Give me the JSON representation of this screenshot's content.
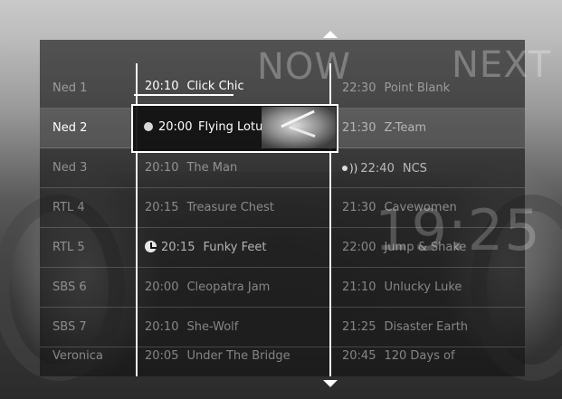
{
  "headers": {
    "now": "NOW",
    "next": "NEXT"
  },
  "clock": "19:25",
  "selected": {
    "time": "20:00",
    "title": "Flying Lotus"
  },
  "rows": [
    {
      "channel": "Ned 1",
      "now_time": "20:10",
      "now_title": "Click Chic",
      "next_time": "22:30",
      "next_title": "Point Blank"
    },
    {
      "channel": "Ned 2",
      "now_time": "20:00",
      "now_title": "Flying Lotus",
      "next_time": "21:30",
      "next_title": "Z-Team"
    },
    {
      "channel": "Ned 3",
      "now_time": "20:10",
      "now_title": "The Man",
      "next_time": "22:40",
      "next_title": "NCS"
    },
    {
      "channel": "RTL 4",
      "now_time": "20:15",
      "now_title": "Treasure Chest",
      "next_time": "21:30",
      "next_title": "Cavewomen"
    },
    {
      "channel": "RTL 5",
      "now_time": "20:15",
      "now_title": "Funky Feet",
      "next_time": "22:00",
      "next_title": "Jump & Shake"
    },
    {
      "channel": "SBS 6",
      "now_time": "20:00",
      "now_title": "Cleopatra Jam",
      "next_time": "21:10",
      "next_title": "Unlucky Luke"
    },
    {
      "channel": "SBS 7",
      "now_time": "20:10",
      "now_title": "She-Wolf",
      "next_time": "21:25",
      "next_title": "Disaster Earth"
    },
    {
      "channel": "Veronica",
      "now_time": "20:05",
      "now_title": "Under The Bridge",
      "next_time": "20:45",
      "next_title": "120 Days of"
    }
  ],
  "icons": {
    "scroll_up": "triangle-up",
    "scroll_down": "triangle-down",
    "reminder": "clock-icon",
    "recording": "broadcast-icon",
    "selected_marker": "dot"
  }
}
